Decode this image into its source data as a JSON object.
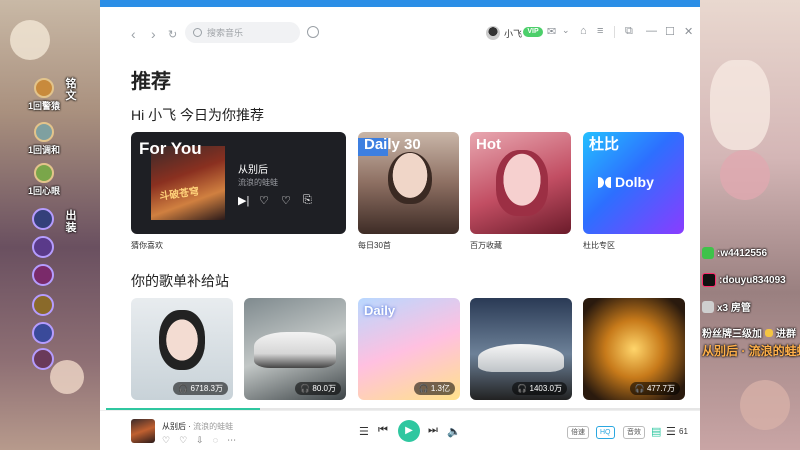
{
  "overlay_left": {
    "top_vertical_text": "铭文",
    "ranks": [
      {
        "label": "1回警猿",
        "color": "#c88a3c"
      },
      {
        "label": "1回调和",
        "color": "#7fa0a0"
      },
      {
        "label": "1回心眼",
        "color": "#7aa64a"
      }
    ],
    "mid_vertical_text": "出装"
  },
  "overlay_right": {
    "wechat": "w4412556",
    "douyin": "douyu834093",
    "x3": "x3 房管",
    "fan": "粉丝牌三级加",
    "join": "进群",
    "now_playing": "从别后 · 流浪的蛙蛙"
  },
  "titlebar": {
    "search_placeholder": "搜索音乐",
    "user_name": "小飞",
    "vip_label": "VIP"
  },
  "main": {
    "title": "推荐",
    "greeting": "Hi 小飞 今日为你推荐",
    "for_you": {
      "tag": "For You",
      "cover_text": "斗破苍穹",
      "song": "从别后",
      "artist": "流浪的蛙蛙",
      "caption": "猜你喜欢"
    },
    "cards": [
      {
        "tag": "Daily 30",
        "caption": "每日30首"
      },
      {
        "tag": "Hot",
        "caption": "百万收藏"
      },
      {
        "tag": "杜比",
        "caption": "杜比专区",
        "logo": "Dolby"
      }
    ],
    "section2_title": "你的歌单补给站",
    "playlists": [
      {
        "plays": "6718.3万"
      },
      {
        "plays": "80.0万"
      },
      {
        "plays": "1.3亿",
        "tag": "Daily"
      },
      {
        "plays": "1403.0万"
      },
      {
        "plays": "477.7万"
      }
    ]
  },
  "player": {
    "song": "从别后",
    "artist": "流浪的蛙蛙",
    "progress": 0.26,
    "speed": "倍速",
    "quality": "HQ",
    "effect": "音效",
    "count": "61"
  }
}
